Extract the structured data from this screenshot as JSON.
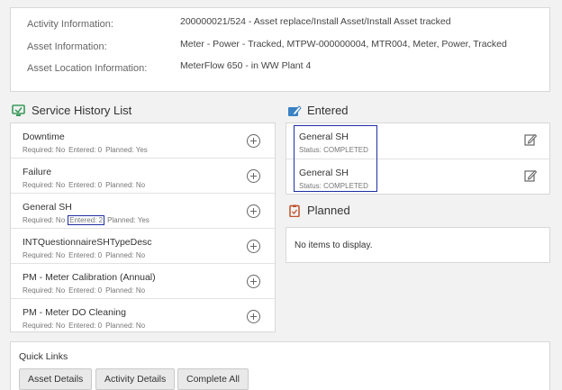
{
  "info": {
    "rows": [
      {
        "label": "Activity Information:",
        "value": "200000021/524 - Asset replace/Install Asset/Install Asset tracked"
      },
      {
        "label": "Asset Information:",
        "value": "Meter - Power - Tracked, MTPW-000000004, MTR004, Meter, Power, Tracked"
      },
      {
        "label": "Asset Location Information:",
        "value": "MeterFlow 650 - in WW Plant 4"
      }
    ]
  },
  "service_history": {
    "title": "Service History List",
    "items": [
      {
        "name": "Downtime",
        "required": "Required: No",
        "entered": "Entered: 0",
        "planned": "Planned: Yes"
      },
      {
        "name": "Failure",
        "required": "Required: No",
        "entered": "Entered: 0",
        "planned": "Planned: No"
      },
      {
        "name": "General SH",
        "required": "Required: No",
        "entered": "Entered: 2",
        "planned": "Planned: Yes"
      },
      {
        "name": "INTQuestionnaireSHTypeDesc",
        "required": "Required: No",
        "entered": "Entered: 0",
        "planned": "Planned: No"
      },
      {
        "name": "PM - Meter Calibration (Annual)",
        "required": "Required: No",
        "entered": "Entered: 0",
        "planned": "Planned: No"
      },
      {
        "name": "PM - Meter DO Cleaning",
        "required": "Required: No",
        "entered": "Entered: 0",
        "planned": "Planned: No"
      }
    ]
  },
  "entered": {
    "title": "Entered",
    "items": [
      {
        "name": "General SH",
        "status": "Status: COMPLETED"
      },
      {
        "name": "General SH",
        "status": "Status: COMPLETED"
      }
    ]
  },
  "planned": {
    "title": "Planned",
    "empty_text": "No items to display."
  },
  "quick_links": {
    "title": "Quick Links",
    "buttons": [
      "Asset Details",
      "Activity Details",
      "Complete All"
    ]
  },
  "colors": {
    "accent_green": "#3a9a5b",
    "accent_blue": "#3b82c4",
    "accent_orange": "#c0522b",
    "highlight": "#1f2fa3"
  }
}
